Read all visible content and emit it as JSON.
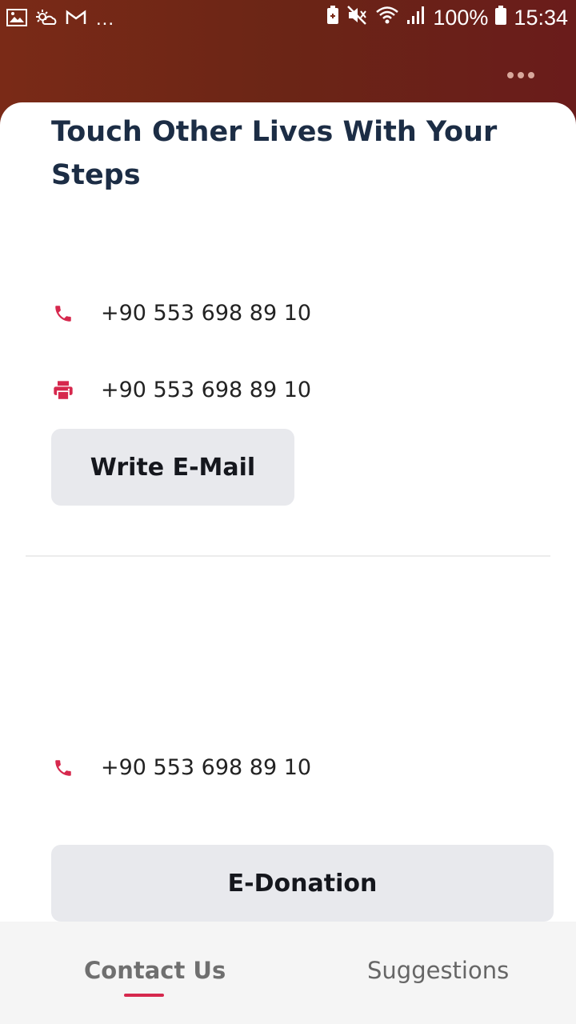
{
  "status_bar": {
    "left_icons": [
      "image-icon",
      "weather-icon",
      "gmail-icon"
    ],
    "overflow": "...",
    "battery_percent": "100%",
    "time": "15:34"
  },
  "header": {
    "menu_icon": "more-horizontal-icon"
  },
  "main": {
    "title": "Touch Other Lives With Your Steps",
    "contact": {
      "phone": "+90 553 698 89 10",
      "fax": "+90 553 698 89 10",
      "email_button": "Write E-Mail"
    },
    "donation": {
      "phone": "+90 553 698 89 10",
      "donate_button": "E-Donation"
    }
  },
  "tabs": [
    {
      "label": "Contact Us",
      "active": true
    },
    {
      "label": "Suggestions",
      "active": false
    }
  ],
  "colors": {
    "accent": "#d6284d",
    "title": "#1c2d45",
    "header_bg": "#6b2516"
  }
}
